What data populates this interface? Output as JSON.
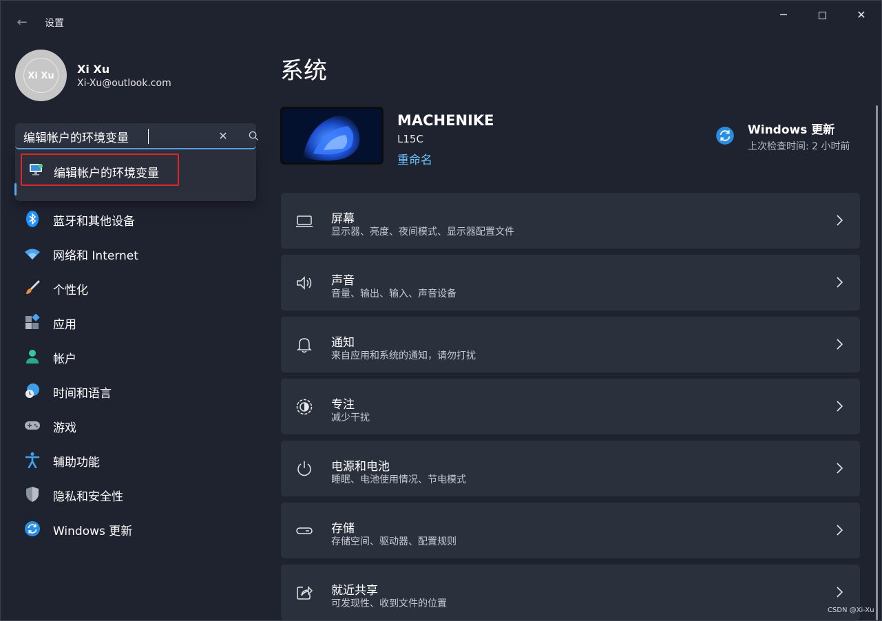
{
  "app": {
    "title": "设置",
    "back_icon": "back-arrow-icon"
  },
  "window_controls": {
    "minimize": "─",
    "close": "✕"
  },
  "user": {
    "name": "Xi Xu",
    "email": "Xi-Xu@outlook.com",
    "avatar_text": "Xi Xu"
  },
  "search": {
    "value": "编辑帐户的环境变量",
    "clear": "✕"
  },
  "suggestion": {
    "label": "编辑帐户的环境变量",
    "icon": "environment-variables-icon"
  },
  "nav": [
    {
      "label": "蓝牙和其他设备",
      "icon": "bluetooth-icon"
    },
    {
      "label": "网络和 Internet",
      "icon": "wifi-icon"
    },
    {
      "label": "个性化",
      "icon": "brush-icon"
    },
    {
      "label": "应用",
      "icon": "apps-icon"
    },
    {
      "label": "帐户",
      "icon": "person-icon"
    },
    {
      "label": "时间和语言",
      "icon": "globe-clock-icon"
    },
    {
      "label": "游戏",
      "icon": "gamepad-icon"
    },
    {
      "label": "辅助功能",
      "icon": "accessibility-icon"
    },
    {
      "label": "隐私和安全性",
      "icon": "shield-icon"
    },
    {
      "label": "Windows 更新",
      "icon": "update-icon"
    }
  ],
  "main": {
    "title": "系统",
    "device": {
      "name": "MACHENIKE",
      "model": "L15C",
      "rename": "重命名"
    },
    "windows_update": {
      "title": "Windows 更新",
      "subtitle": "上次检查时间: 2 小时前"
    },
    "cards": [
      {
        "title": "屏幕",
        "subtitle": "显示器、亮度、夜间模式、显示器配置文件",
        "icon": "monitor-icon"
      },
      {
        "title": "声音",
        "subtitle": "音量、输出、输入、声音设备",
        "icon": "speaker-icon"
      },
      {
        "title": "通知",
        "subtitle": "来自应用和系统的通知，请勿打扰",
        "icon": "bell-icon"
      },
      {
        "title": "专注",
        "subtitle": "减少干扰",
        "icon": "focus-icon"
      },
      {
        "title": "电源和电池",
        "subtitle": "睡眠、电池使用情况、节电模式",
        "icon": "power-icon"
      },
      {
        "title": "存储",
        "subtitle": "存储空间、驱动器、配置规则",
        "icon": "storage-icon"
      },
      {
        "title": "就近共享",
        "subtitle": "可发现性、收到文件的位置",
        "icon": "share-icon"
      }
    ]
  },
  "watermark": "CSDN @Xi-Xu",
  "colors": {
    "accent": "#5aa7ee",
    "link": "#6cc6ff",
    "highlight_border": "#e0262a",
    "card_bg": "#2b303d",
    "window_bg": "#1f2330"
  }
}
